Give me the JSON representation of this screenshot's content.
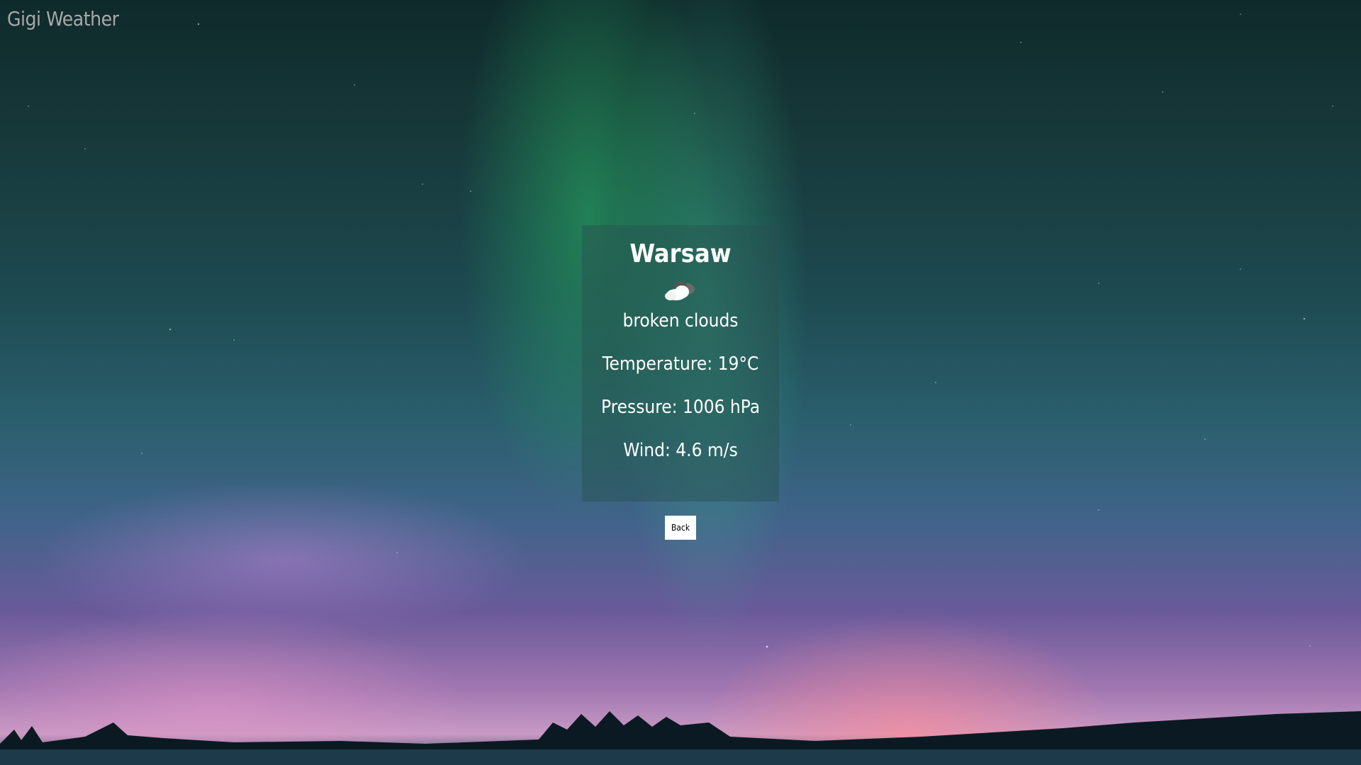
{
  "app": {
    "brand": "Gigi Weather"
  },
  "weather": {
    "city": "Warsaw",
    "icon": "broken-clouds-icon",
    "description": "broken clouds",
    "temperature": "Temperature: 19°C",
    "pressure": "Pressure: 1006 hPa",
    "wind": "Wind: 4.6 m/s"
  },
  "actions": {
    "back_label": "Back"
  },
  "colors": {
    "card_background": "#285050",
    "button_background": "#ffffff",
    "brand_text": "#a8a8a8"
  }
}
